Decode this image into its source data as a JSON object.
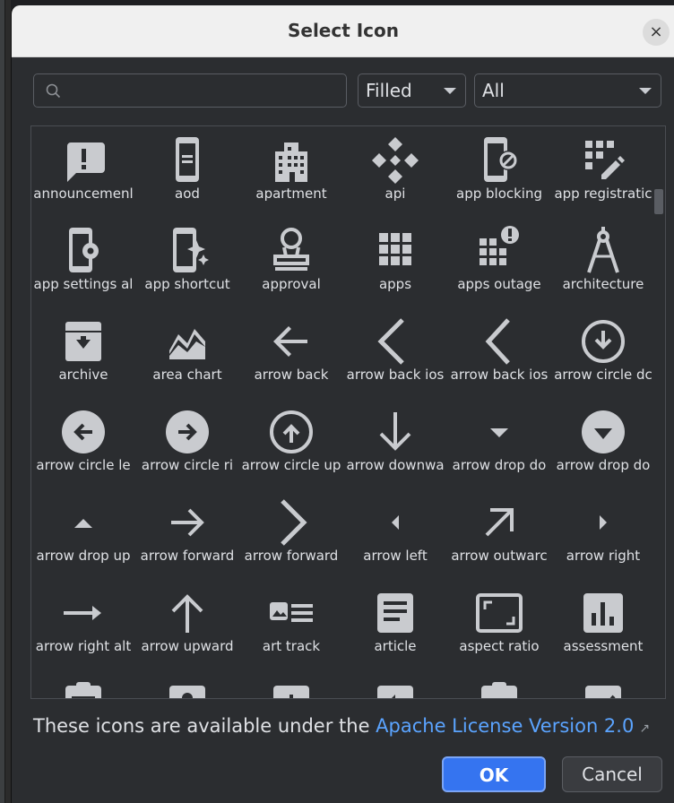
{
  "dialog": {
    "title": "Select Icon",
    "close_label": "×",
    "search": {
      "value": "",
      "placeholder": ""
    },
    "style_select": "Filled",
    "category_select": "All",
    "footer_text": "These icons are available under the ",
    "license_link": "Apache License Version 2.0",
    "license_ext": "↗",
    "ok_label": "OK",
    "cancel_label": "Cancel"
  },
  "icons": [
    {
      "label": "announcemenl",
      "icon": "announcement-icon"
    },
    {
      "label": "aod",
      "icon": "aod-icon"
    },
    {
      "label": "apartment",
      "icon": "apartment-icon"
    },
    {
      "label": "api",
      "icon": "api-icon"
    },
    {
      "label": "app blocking",
      "icon": "app-blocking-icon"
    },
    {
      "label": "app registratic",
      "icon": "app-registration-icon"
    },
    {
      "label": "app settings al",
      "icon": "app-settings-alt-icon"
    },
    {
      "label": "app shortcut",
      "icon": "app-shortcut-icon"
    },
    {
      "label": "approval",
      "icon": "approval-icon"
    },
    {
      "label": "apps",
      "icon": "apps-icon"
    },
    {
      "label": "apps outage",
      "icon": "apps-outage-icon"
    },
    {
      "label": "architecture",
      "icon": "architecture-icon"
    },
    {
      "label": "archive",
      "icon": "archive-icon"
    },
    {
      "label": "area chart",
      "icon": "area-chart-icon"
    },
    {
      "label": "arrow back",
      "icon": "arrow-back-icon"
    },
    {
      "label": "arrow back ios",
      "icon": "arrow-back-ios-icon"
    },
    {
      "label": "arrow back ios",
      "icon": "arrow-back-ios-new-icon"
    },
    {
      "label": "arrow circle dc",
      "icon": "arrow-circle-down-icon"
    },
    {
      "label": "arrow circle le",
      "icon": "arrow-circle-left-icon"
    },
    {
      "label": "arrow circle ri",
      "icon": "arrow-circle-right-icon"
    },
    {
      "label": "arrow circle up",
      "icon": "arrow-circle-up-icon"
    },
    {
      "label": "arrow downwa",
      "icon": "arrow-downward-icon"
    },
    {
      "label": "arrow drop do",
      "icon": "arrow-drop-down-icon"
    },
    {
      "label": "arrow drop do",
      "icon": "arrow-drop-down-circle-icon"
    },
    {
      "label": "arrow drop up",
      "icon": "arrow-drop-up-icon"
    },
    {
      "label": "arrow forward",
      "icon": "arrow-forward-icon"
    },
    {
      "label": "arrow forward",
      "icon": "arrow-forward-ios-icon"
    },
    {
      "label": "arrow left",
      "icon": "arrow-left-icon"
    },
    {
      "label": "arrow outwarc",
      "icon": "arrow-outward-icon"
    },
    {
      "label": "arrow right",
      "icon": "arrow-right-icon"
    },
    {
      "label": "arrow right alt",
      "icon": "arrow-right-alt-icon"
    },
    {
      "label": "arrow upward",
      "icon": "arrow-upward-icon"
    },
    {
      "label": "art track",
      "icon": "art-track-icon"
    },
    {
      "label": "article",
      "icon": "article-icon"
    },
    {
      "label": "aspect ratio",
      "icon": "aspect-ratio-icon"
    },
    {
      "label": "assessment",
      "icon": "assessment-icon"
    },
    {
      "label": "",
      "icon": "assignment-icon"
    },
    {
      "label": "",
      "icon": "assignment-ind-icon"
    },
    {
      "label": "",
      "icon": "assignment-late-icon"
    },
    {
      "label": "",
      "icon": "assignment-return-icon"
    },
    {
      "label": "",
      "icon": "assignment-returned-icon"
    },
    {
      "label": "",
      "icon": "assignment-turned-in-icon"
    }
  ]
}
